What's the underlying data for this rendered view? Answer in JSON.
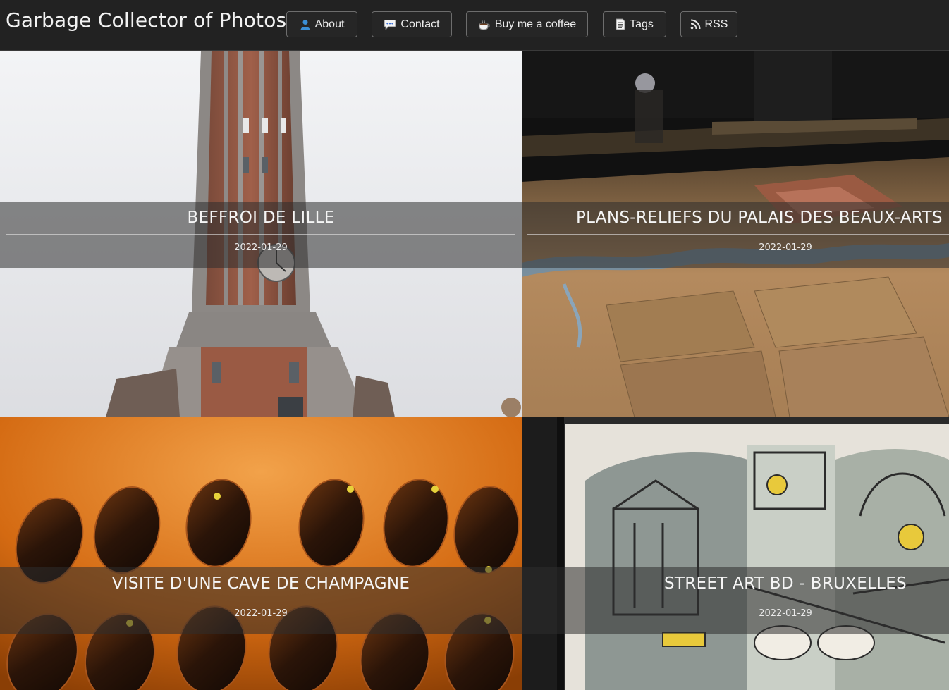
{
  "site": {
    "title": "Garbage Collector of Photos"
  },
  "nav": [
    {
      "label": "About",
      "icon": "person-icon"
    },
    {
      "label": "Contact",
      "icon": "speech-bubble-icon"
    },
    {
      "label": "Buy me a coffee",
      "icon": "coffee-icon"
    },
    {
      "label": "Tags",
      "icon": "document-icon"
    },
    {
      "label": "RSS",
      "icon": "rss-icon"
    }
  ],
  "posts": [
    {
      "title": "BEFFROI DE LILLE",
      "date": "2022-01-29"
    },
    {
      "title": "PLANS-RELIEFS DU PALAIS DES BEAUX-ARTS DE",
      "date": "2022-01-29"
    },
    {
      "title": "VISITE D'UNE CAVE DE CHAMPAGNE",
      "date": "2022-01-29"
    },
    {
      "title": "STREET ART BD - BRUXELLES",
      "date": "2022-01-29"
    }
  ]
}
